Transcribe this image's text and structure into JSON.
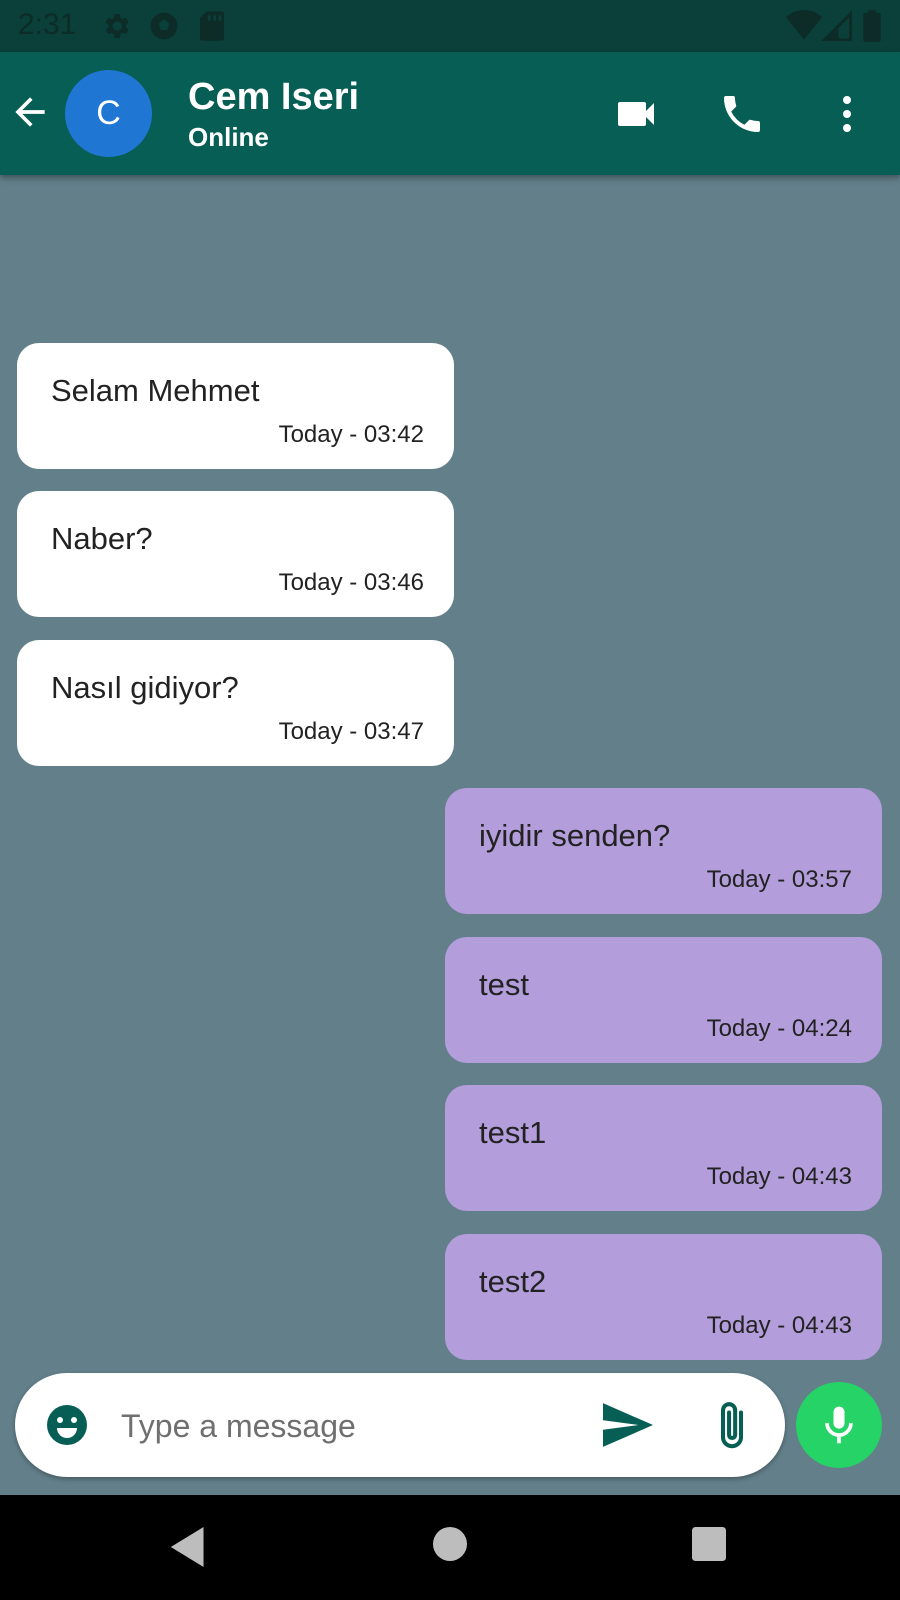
{
  "status_bar": {
    "time": "2:31",
    "icons": [
      "settings-icon",
      "soccer-ball-icon",
      "sd-card-icon",
      "wifi-icon",
      "signal-icon",
      "battery-icon"
    ]
  },
  "header": {
    "avatar_letter": "C",
    "contact_name": "Cem Iseri",
    "status": "Online",
    "colors": {
      "app_bar": "#075e54",
      "avatar": "#1f76d3"
    },
    "icons": [
      "back-arrow-icon",
      "video-call-icon",
      "phone-icon",
      "more-vert-icon"
    ]
  },
  "messages": [
    {
      "direction": "incoming",
      "text": "Selam Mehmet",
      "time": "Today - 03:42"
    },
    {
      "direction": "incoming",
      "text": "Naber?",
      "time": "Today - 03:46"
    },
    {
      "direction": "incoming",
      "text": "Nasıl gidiyor?",
      "time": "Today - 03:47"
    },
    {
      "direction": "outgoing",
      "text": "iyidir senden?",
      "time": "Today - 03:57"
    },
    {
      "direction": "outgoing",
      "text": "test",
      "time": "Today - 04:24"
    },
    {
      "direction": "outgoing",
      "text": "test1",
      "time": "Today - 04:43"
    },
    {
      "direction": "outgoing",
      "text": "test2",
      "time": "Today - 04:43"
    }
  ],
  "composer": {
    "placeholder": "Type a message",
    "value": "",
    "icons": [
      "emoji-icon",
      "send-icon",
      "attach-icon",
      "mic-icon"
    ],
    "colors": {
      "mic_button": "#25d366",
      "accent": "#075e54"
    }
  },
  "colors": {
    "chat_background": "#627f8a",
    "incoming_bubble": "#ffffff",
    "outgoing_bubble": "#b39ddb"
  },
  "nav_bar": {
    "icons": [
      "nav-back-icon",
      "nav-home-icon",
      "nav-recents-icon"
    ]
  }
}
